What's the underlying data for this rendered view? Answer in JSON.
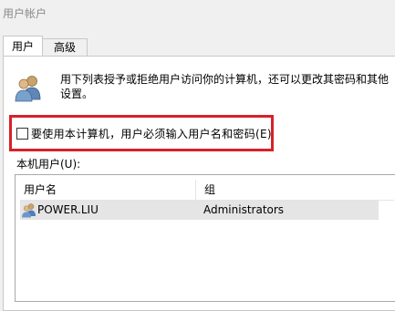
{
  "window": {
    "title": "用户帐户"
  },
  "tabs": [
    {
      "label": "用户",
      "active": true
    },
    {
      "label": "高级",
      "active": false
    }
  ],
  "description": "用下列表授予或拒绝用户访问你的计算机，还可以更改其密码和其他设置。",
  "checkbox": {
    "label": "要使用本计算机，用户必须输入用户名和密码(E)",
    "checked": false
  },
  "user_list": {
    "label": "本机用户(U):",
    "columns": [
      "用户名",
      "组"
    ],
    "rows": [
      {
        "name": "POWER.LIU",
        "group": "Administrators",
        "selected": true
      }
    ]
  },
  "colors": {
    "highlight_box": "#d8202a",
    "selected_row": "#e5e5e5"
  },
  "icons": {
    "users": "users-group-icon",
    "user": "user-account-icon"
  }
}
